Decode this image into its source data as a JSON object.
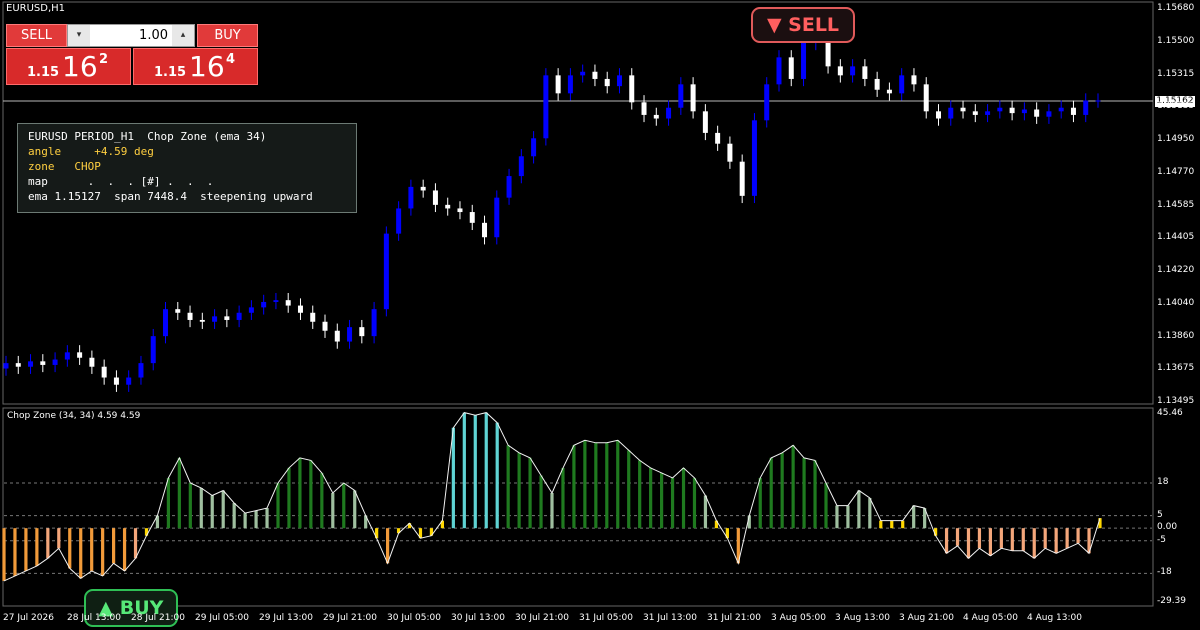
{
  "window": {
    "title": "EURUSD,H1"
  },
  "trade_panel": {
    "sell_label": "SELL",
    "buy_label": "BUY",
    "lot": "1.00",
    "sell_price_small": "1.15",
    "sell_price_big": "16",
    "sell_price_sup": "2",
    "buy_price_small": "1.15",
    "buy_price_big": "16",
    "buy_price_sup": "4"
  },
  "info_box": {
    "line1": "EURUSD PERIOD_H1  Chop Zone (ema 34)",
    "line2_label": "angle",
    "line2_value": "     +4.59 deg",
    "line3_label": "zone",
    "line3_value": "   CHOP",
    "line4": "map      .  .  . [#] .  .  .",
    "line5": "ema 1.15127  span 7448.4  steepening upward"
  },
  "signals": {
    "sell": "▼ SELL",
    "buy": "▲ BUY"
  },
  "indicator": {
    "title": "Chop Zone (34, 34) 4.59 4.59"
  },
  "price_axis": [
    "1.15680",
    "1.15500",
    "1.15315",
    "1.15135",
    "1.14950",
    "1.14770",
    "1.14585",
    "1.14405",
    "1.14220",
    "1.14040",
    "1.13860",
    "1.13675",
    "1.13495"
  ],
  "current_price": "1.15162",
  "indicator_axis": [
    "45.46",
    "18",
    "5",
    "0.00",
    "-5",
    "-18",
    "-29.39"
  ],
  "time_axis": [
    "27 Jul 2026",
    "28 Jul 13:00",
    "28 Jul 21:00",
    "29 Jul 05:00",
    "29 Jul 13:00",
    "29 Jul 21:00",
    "30 Jul 05:00",
    "30 Jul 13:00",
    "30 Jul 21:00",
    "31 Jul 05:00",
    "31 Jul 13:00",
    "31 Jul 21:00",
    "3 Aug 05:00",
    "3 Aug 13:00",
    "3 Aug 21:00",
    "4 Aug 05:00",
    "4 Aug 13:00"
  ],
  "colors": {
    "bull_candle": "#0000ff",
    "bear_candle": "#ffffff",
    "chop_dark_green": "#1f7a1f",
    "chop_light_green": "#9fbf9f",
    "chop_cyan": "#5fd3d3",
    "chop_yellow": "#ffd700",
    "chop_orange": "#f29b3a",
    "chop_salmon": "#f4a67a"
  },
  "chart_data": [
    {
      "type": "candlestick",
      "title": "EURUSD,H1",
      "ylim": [
        1.13495,
        1.1568
      ],
      "current_price": 1.15162,
      "close_path": [
        1.137,
        1.1368,
        1.1371,
        1.1369,
        1.1372,
        1.1376,
        1.1373,
        1.1368,
        1.1362,
        1.1358,
        1.1362,
        1.137,
        1.1385,
        1.14,
        1.1398,
        1.1394,
        1.1393,
        1.1396,
        1.1394,
        1.1398,
        1.1401,
        1.1404,
        1.1405,
        1.1402,
        1.1398,
        1.1393,
        1.1388,
        1.1382,
        1.139,
        1.1385,
        1.14,
        1.1442,
        1.1456,
        1.1468,
        1.1466,
        1.1458,
        1.1456,
        1.1454,
        1.1448,
        1.144,
        1.1462,
        1.1474,
        1.1485,
        1.1495,
        1.153,
        1.152,
        1.153,
        1.1532,
        1.1528,
        1.1524,
        1.153,
        1.1515,
        1.1508,
        1.1506,
        1.1512,
        1.1525,
        1.151,
        1.1498,
        1.1492,
        1.1482,
        1.1463,
        1.1505,
        1.1525,
        1.154,
        1.1528,
        1.1548,
        1.155,
        1.1535,
        1.153,
        1.1535,
        1.1528,
        1.1522,
        1.152,
        1.153,
        1.1525,
        1.151,
        1.1506,
        1.1512,
        1.151,
        1.1508,
        1.151,
        1.1512,
        1.1509,
        1.1511,
        1.1507,
        1.151,
        1.1512,
        1.1508,
        1.1516,
        1.1516
      ]
    },
    {
      "type": "bar",
      "title": "Chop Zone (34, 34) 4.59 4.59",
      "ylim": [
        -29.39,
        45.46
      ],
      "reference_lines": [
        18,
        5,
        0,
        -5,
        -18
      ],
      "values": [
        -21,
        -19,
        -17,
        -15,
        -12,
        -8,
        -16,
        -20,
        -17,
        -19,
        -14,
        -17,
        -12,
        -3,
        5,
        20,
        28,
        18,
        16,
        13,
        15,
        10,
        6,
        7,
        8,
        18,
        24,
        28,
        27,
        22,
        14,
        18,
        15,
        5,
        -4,
        -14,
        -2,
        2,
        -4,
        -3,
        3,
        40,
        46,
        45,
        46,
        42,
        33,
        30,
        28,
        21,
        14,
        24,
        33,
        35,
        34,
        34,
        35,
        31,
        27,
        24,
        22,
        20,
        24,
        20,
        13,
        3,
        -4,
        -14,
        5,
        20,
        28,
        30,
        33,
        28,
        27,
        18,
        9,
        9,
        15,
        12,
        3,
        3,
        3,
        9,
        8,
        -3,
        -10,
        -7,
        -12,
        -8,
        -11,
        -8,
        -9,
        -9,
        -12,
        -8,
        -10,
        -8,
        -6,
        -10,
        4
      ]
    }
  ]
}
